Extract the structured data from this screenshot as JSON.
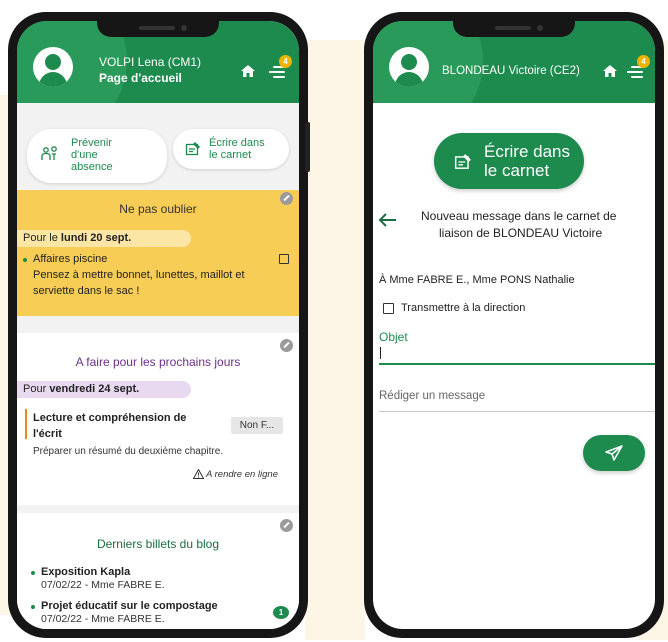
{
  "colors": {
    "primary_green": "#1d8a4e",
    "accent_yellow": "#f7cd55",
    "badge_yellow": "#f0b400",
    "purple": "#6b2f8a",
    "orange_bar": "#e38a23"
  },
  "left_phone": {
    "header": {
      "name": "VOLPI Lena (CM1)",
      "subtitle": "Page d'accueil",
      "badge_count": "4",
      "icons": [
        "avatar-icon",
        "home-icon",
        "menu-icon"
      ]
    },
    "actions": [
      {
        "label_line1": "Prévenir",
        "label_line2": "d'une",
        "label_line3": "absence",
        "icon": "absence-icon"
      },
      {
        "label_line1": "Écrire dans",
        "label_line2": "le carnet",
        "icon": "notebook-icon"
      }
    ],
    "reminder": {
      "title": "Ne pas oublier",
      "date_prefix": "Pour le",
      "date": "lundi 20 sept.",
      "item_title": "Affaires piscine",
      "item_text_line1": "Pensez à mettre bonnet, lunettes, maillot et",
      "item_text_line2": "serviette dans le sac !"
    },
    "homework": {
      "title": "A faire pour les prochains jours",
      "date_prefix": "Pour",
      "date": "vendredi 24 sept.",
      "task_title_line1": "Lecture et compréhension de",
      "task_title_line2": "l'écrit",
      "status": "Non F...",
      "task_desc": "Préparer un résumé du deuxième chapitre.",
      "online_note": "A rendre en ligne"
    },
    "blog": {
      "title": "Derniers billets du blog",
      "posts": [
        {
          "title": "Exposition Kapla",
          "meta": "07/02/22 - Mme FABRE E."
        },
        {
          "title": "Projet éducatif sur le compostage",
          "meta": "07/02/22 - Mme FABRE E.",
          "comments": "1"
        }
      ]
    }
  },
  "right_phone": {
    "header": {
      "name": "BLONDEAU Victoire (CE2)",
      "badge_count": "4",
      "icons": [
        "avatar-icon",
        "home-icon",
        "menu-icon"
      ]
    },
    "write_button": {
      "line1": "Écrire dans",
      "line2": "le carnet",
      "icon": "notebook-icon"
    },
    "message_title_line1": "Nouveau message dans le carnet de",
    "message_title_line2": "liaison de BLONDEAU Victoire",
    "recipients": "À Mme FABRE E., Mme PONS Nathalie",
    "forward_label": "Transmettre à la direction",
    "subject_label": "Objet",
    "message_placeholder": "Rédiger un message",
    "icons": [
      "back-arrow-icon",
      "send-icon"
    ]
  }
}
